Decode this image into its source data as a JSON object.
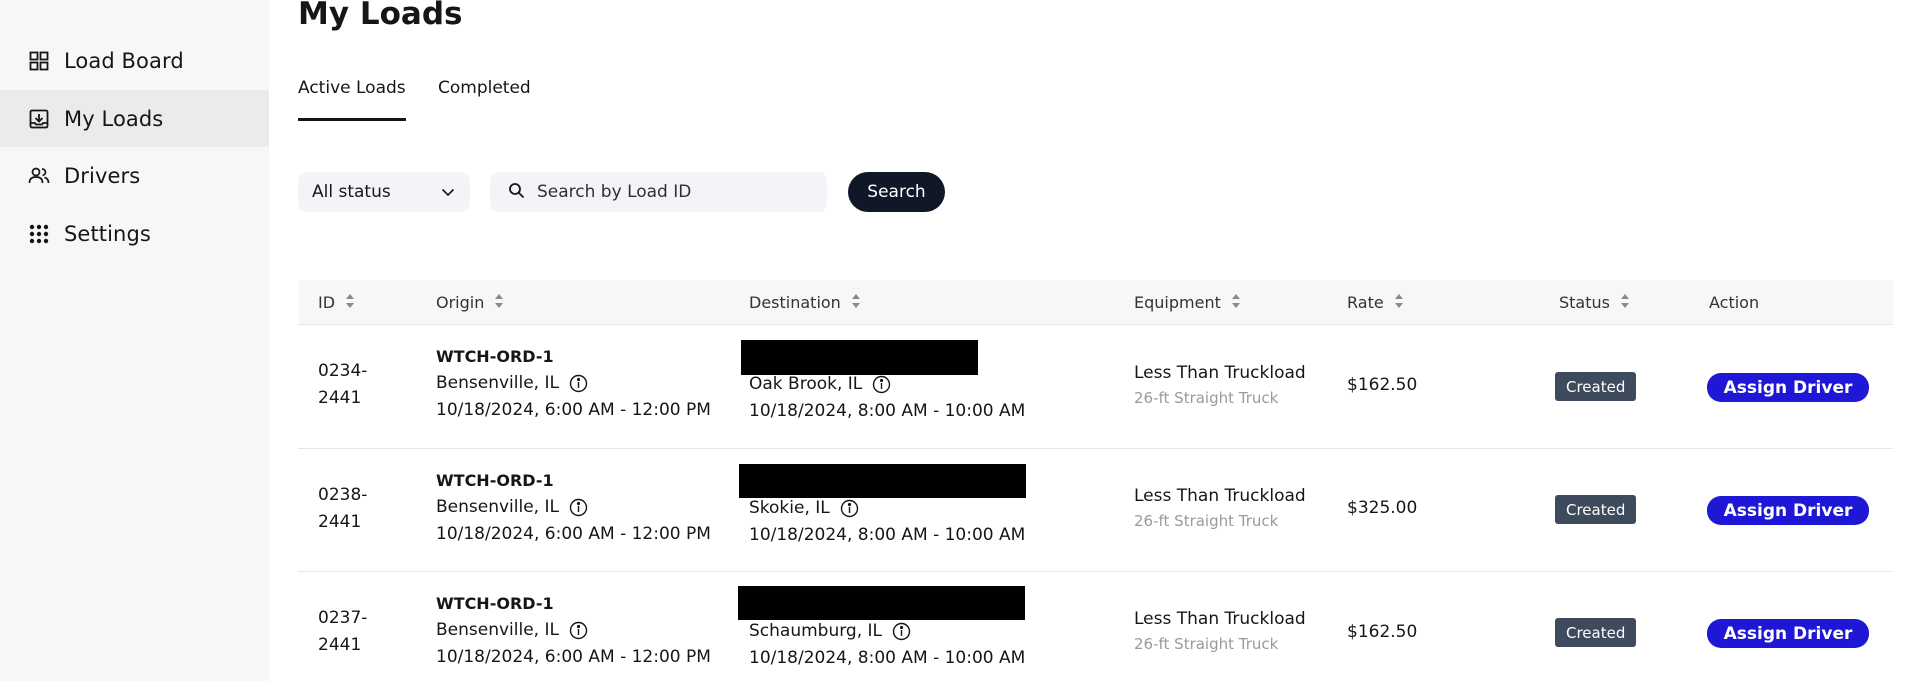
{
  "sidebar": {
    "items": [
      {
        "label": "Load Board",
        "icon": "grid-icon",
        "active": false
      },
      {
        "label": "My Loads",
        "icon": "inbox-download-icon",
        "active": true
      },
      {
        "label": "Drivers",
        "icon": "users-icon",
        "active": false
      },
      {
        "label": "Settings",
        "icon": "dots-grid-icon",
        "active": false
      }
    ]
  },
  "page": {
    "title": "My Loads"
  },
  "tabs": [
    {
      "label": "Active Loads",
      "active": true
    },
    {
      "label": "Completed",
      "active": false
    }
  ],
  "filters": {
    "status_value": "All status",
    "search_placeholder": "Search by Load ID",
    "search_button": "Search"
  },
  "table": {
    "columns": [
      "ID",
      "Origin",
      "Destination",
      "Equipment",
      "Rate",
      "Status",
      "Action"
    ],
    "rows": [
      {
        "id_line1": "0234-",
        "id_line2": "2441",
        "origin_code": "WTCH-ORD-1",
        "origin_city": "Bensenville, IL",
        "origin_window": "10/18/2024, 6:00 AM - 12:00 PM",
        "dest_city": "Oak Brook, IL",
        "dest_window": "10/18/2024, 8:00 AM - 10:00 AM",
        "equipment": "Less Than Truckload",
        "equipment_sub": "26-ft Straight Truck",
        "rate": "$162.50",
        "status": "Created",
        "action": "Assign Driver"
      },
      {
        "id_line1": "0238-",
        "id_line2": "2441",
        "origin_code": "WTCH-ORD-1",
        "origin_city": "Bensenville, IL",
        "origin_window": "10/18/2024, 6:00 AM - 12:00 PM",
        "dest_city": "Skokie, IL",
        "dest_window": "10/18/2024, 8:00 AM - 10:00 AM",
        "equipment": "Less Than Truckload",
        "equipment_sub": "26-ft Straight Truck",
        "rate": "$325.00",
        "status": "Created",
        "action": "Assign Driver"
      },
      {
        "id_line1": "0237-",
        "id_line2": "2441",
        "origin_code": "WTCH-ORD-1",
        "origin_city": "Bensenville, IL",
        "origin_window": "10/18/2024, 6:00 AM - 12:00 PM",
        "dest_city": "Schaumburg, IL",
        "dest_window": "10/18/2024, 8:00 AM - 10:00 AM",
        "equipment": "Less Than Truckload",
        "equipment_sub": "26-ft Straight Truck",
        "rate": "$162.50",
        "status": "Created",
        "action": "Assign Driver"
      }
    ]
  },
  "colors": {
    "sidebar_bg": "#f7f7f7",
    "active_nav_bg": "#ebebeb",
    "search_button_bg": "#101828",
    "badge_bg": "#3d4b5c",
    "assign_button_bg": "#1f17d6"
  }
}
